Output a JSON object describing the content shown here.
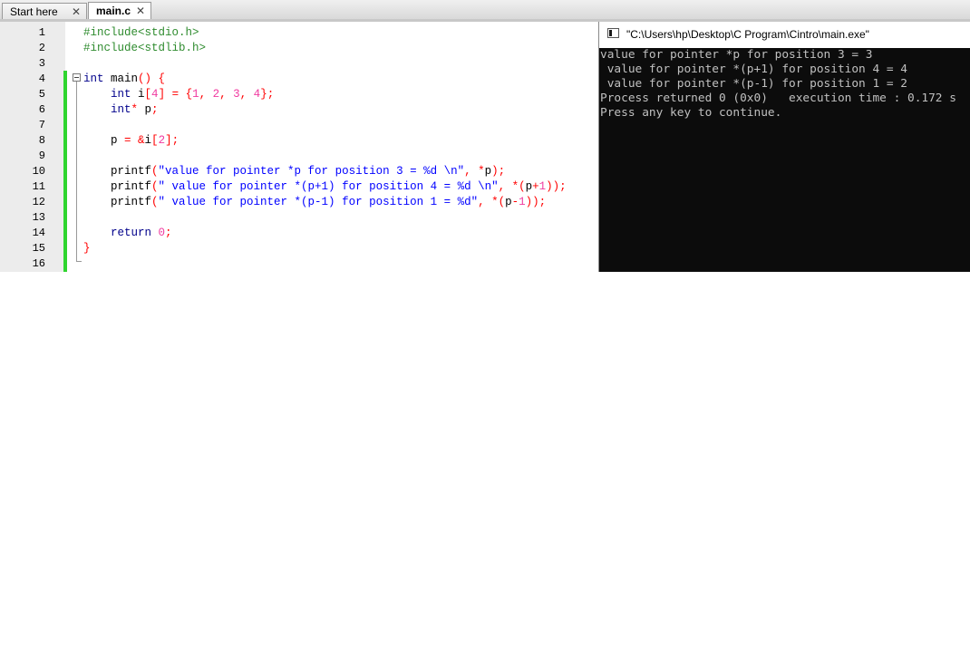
{
  "tabs": [
    {
      "label": "Start here",
      "close": "✕"
    },
    {
      "label": "main.c",
      "close": "✕"
    }
  ],
  "editor": {
    "line_numbers": [
      "1",
      "2",
      "3",
      "4",
      "5",
      "6",
      "7",
      "8",
      "9",
      "10",
      "11",
      "12",
      "13",
      "14",
      "15",
      "16"
    ],
    "lines": [
      [
        {
          "t": "#include<stdio.h>",
          "c": "pp"
        }
      ],
      [
        {
          "t": "#include<stdlib.h>",
          "c": "pp"
        }
      ],
      [],
      [
        {
          "t": "int",
          "c": "kw"
        },
        {
          "t": " main",
          "c": "plain"
        },
        {
          "t": "() {",
          "c": "op"
        }
      ],
      [
        {
          "t": "    int",
          "c": "kw"
        },
        {
          "t": " i",
          "c": "plain"
        },
        {
          "t": "[",
          "c": "op"
        },
        {
          "t": "4",
          "c": "num"
        },
        {
          "t": "] = {",
          "c": "op"
        },
        {
          "t": "1",
          "c": "num"
        },
        {
          "t": ", ",
          "c": "op"
        },
        {
          "t": "2",
          "c": "num"
        },
        {
          "t": ", ",
          "c": "op"
        },
        {
          "t": "3",
          "c": "num"
        },
        {
          "t": ", ",
          "c": "op"
        },
        {
          "t": "4",
          "c": "num"
        },
        {
          "t": "};",
          "c": "op"
        }
      ],
      [
        {
          "t": "    int",
          "c": "kw"
        },
        {
          "t": "*",
          "c": "op"
        },
        {
          "t": " p",
          "c": "plain"
        },
        {
          "t": ";",
          "c": "op"
        }
      ],
      [],
      [
        {
          "t": "    p ",
          "c": "plain"
        },
        {
          "t": "= &",
          "c": "op"
        },
        {
          "t": "i",
          "c": "plain"
        },
        {
          "t": "[",
          "c": "op"
        },
        {
          "t": "2",
          "c": "num"
        },
        {
          "t": "];",
          "c": "op"
        }
      ],
      [],
      [
        {
          "t": "    printf",
          "c": "plain"
        },
        {
          "t": "(",
          "c": "op"
        },
        {
          "t": "\"value for pointer *p for position 3 = %d \\n\"",
          "c": "str"
        },
        {
          "t": ", *",
          "c": "op"
        },
        {
          "t": "p",
          "c": "plain"
        },
        {
          "t": ");",
          "c": "op"
        }
      ],
      [
        {
          "t": "    printf",
          "c": "plain"
        },
        {
          "t": "(",
          "c": "op"
        },
        {
          "t": "\" value for pointer *(p+1) for position 4 = %d \\n\"",
          "c": "str"
        },
        {
          "t": ", *(",
          "c": "op"
        },
        {
          "t": "p",
          "c": "plain"
        },
        {
          "t": "+",
          "c": "op"
        },
        {
          "t": "1",
          "c": "num"
        },
        {
          "t": "));",
          "c": "op"
        }
      ],
      [
        {
          "t": "    printf",
          "c": "plain"
        },
        {
          "t": "(",
          "c": "op"
        },
        {
          "t": "\" value for pointer *(p-1) for position 1 = %d\"",
          "c": "str"
        },
        {
          "t": ", *(",
          "c": "op"
        },
        {
          "t": "p",
          "c": "plain"
        },
        {
          "t": "-",
          "c": "op"
        },
        {
          "t": "1",
          "c": "num"
        },
        {
          "t": "));",
          "c": "op"
        }
      ],
      [],
      [
        {
          "t": "    return",
          "c": "kw"
        },
        {
          "t": " ",
          "c": "plain"
        },
        {
          "t": "0",
          "c": "num"
        },
        {
          "t": ";",
          "c": "op"
        }
      ],
      [
        {
          "t": "}",
          "c": "op"
        }
      ],
      []
    ]
  },
  "console": {
    "title": "\"C:\\Users\\hp\\Desktop\\C Program\\Cintro\\main.exe\"",
    "output": [
      "value for pointer *p for position 3 = 3",
      " value for pointer *(p+1) for position 4 = 4",
      " value for pointer *(p-1) for position 1 = 2",
      "Process returned 0 (0x0)   execution time : 0.172 s",
      "Press any key to continue."
    ]
  },
  "colors": {
    "keyword": "#00008b",
    "preprocessor": "#2e8b2e",
    "string": "#0000ff",
    "number": "#f03aa0",
    "operator": "#ff0000",
    "change_marker": "#2fd52f",
    "console_bg": "#0c0c0c",
    "console_text": "#c0c0c0"
  },
  "icons": {
    "tab_close": "close-icon",
    "console_window": "console-window-icon",
    "fold": "fold-minus-icon"
  }
}
